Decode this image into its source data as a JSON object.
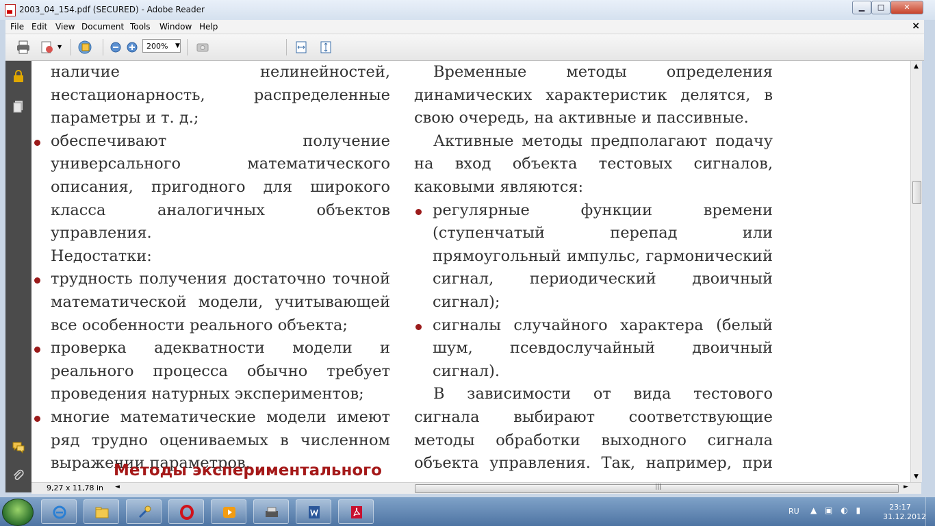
{
  "window": {
    "title": "2003_04_154.pdf (SECURED) - Adobe Reader",
    "minimize": "▁",
    "maximize": "□",
    "close": "✕"
  },
  "menu": {
    "items": [
      "File",
      "Edit",
      "View",
      "Document",
      "Tools",
      "Window",
      "Help"
    ],
    "close": "×"
  },
  "toolbar": {
    "zoom_value": "200%"
  },
  "document": {
    "left": {
      "lines_intro": "наличие нелинейностей, нестационарность, распределенные параметры и т. д.;",
      "bullet1": "обеспечивают получение универсального математического описания, пригодного для широкого класса аналогичных объектов управления.",
      "disadvantages_label": "Недостатки:",
      "bullet2": "трудность получения достаточно точной математической модели, учитывающей все особенности реального объекта;",
      "bullet3": "проверка адекватности модели и реального процесса обычно требует проведения натурных экспериментов;",
      "bullet4": "многие математические модели имеют ряд трудно оцениваемых в численном выражении параметров.",
      "section_heading": "Методы экспериментального"
    },
    "right": {
      "para1": "Временные методы определения динамических характеристик делятся, в свою очередь, на активные и пассивные.",
      "para2": "Активные методы предполагают подачу на вход объекта тестовых сигналов, каковыми являются:",
      "bullet1": "регулярные функции времени (ступенчатый перепад или прямоугольный импульс, гармонический сигнал, периодический двоичный сигнал);",
      "bullet2": "сигналы случайного характера (белый шум, псевдослучайный двоичный сигнал).",
      "para3": "В зависимости от вида тестового сигнала выбирают соответствующие методы обработки выходного сигнала объекта управления. Так, например, при подаче ступенчатого перепада снимают кривую разгона объекта, а при подаче прямоугольного импульса снимают"
    }
  },
  "status": {
    "page_size": "9,27 x 11,78 in"
  },
  "taskbar": {
    "language": "RU",
    "time": "23:17",
    "date": "31.12.2012"
  },
  "colors": {
    "bullet": "#9b1b1b",
    "heading": "#a41818",
    "text": "#333333"
  }
}
